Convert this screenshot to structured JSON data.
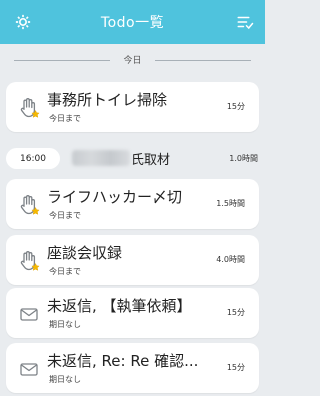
{
  "header": {
    "title": "Todo一覧",
    "left_icon": "gear-icon",
    "right_icon": "list-check-icon",
    "bg_color": "#4fc3dd"
  },
  "section": {
    "label": "今日"
  },
  "tasks": [
    {
      "name": "事務所トイレ掃除",
      "sub": "今日まで",
      "duration": "15分",
      "icon": "hand-star-icon"
    },
    {
      "name": "ライフハッカー〆切",
      "sub": "今日まで",
      "duration": "1.5時間",
      "icon": "hand-star-icon"
    },
    {
      "name": "座談会収録",
      "sub": "今日まで",
      "duration": "4.0時間",
      "icon": "hand-star-icon"
    },
    {
      "name": "未返信, 【執筆依頼】",
      "sub": "期日なし",
      "duration": "15分",
      "icon": "mail-icon"
    },
    {
      "name": "未返信, Re: Re 確認...",
      "sub": "期日なし",
      "duration": "15分",
      "icon": "mail-icon"
    }
  ],
  "event": {
    "time": "16:00",
    "title": "氏取材",
    "duration": "1.0時間"
  }
}
